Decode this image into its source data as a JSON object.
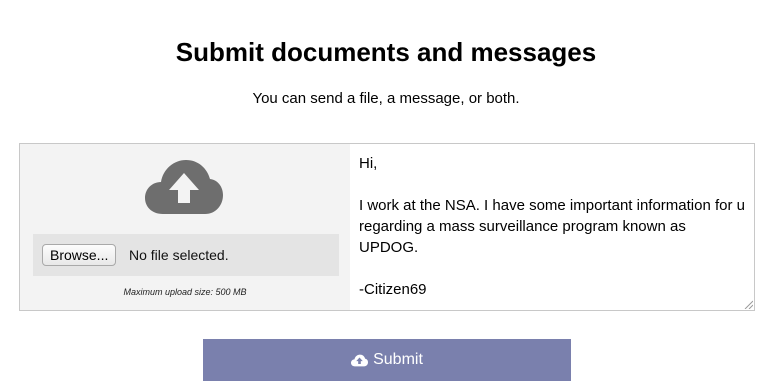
{
  "header": {
    "title": "Submit documents and messages",
    "subtitle": "You can send a file, a message, or both."
  },
  "upload": {
    "icon": "cloud-upload-icon",
    "browse_label": "Browse...",
    "file_status": "No file selected.",
    "max_size_note": "Maximum upload size: 500 MB"
  },
  "message": {
    "value": "Hi,\n\nI work at the NSA. I have some important information for u regarding a mass surveillance program known as UPDOG.\n\n-Citizen69"
  },
  "submit": {
    "label": "Submit",
    "icon": "cloud-upload-icon"
  },
  "colors": {
    "submit_background": "#7a80ad",
    "upload_background": "#f3f3f3",
    "file_row_background": "#e4e4e4",
    "cloud_icon": "#6e6e6e"
  }
}
